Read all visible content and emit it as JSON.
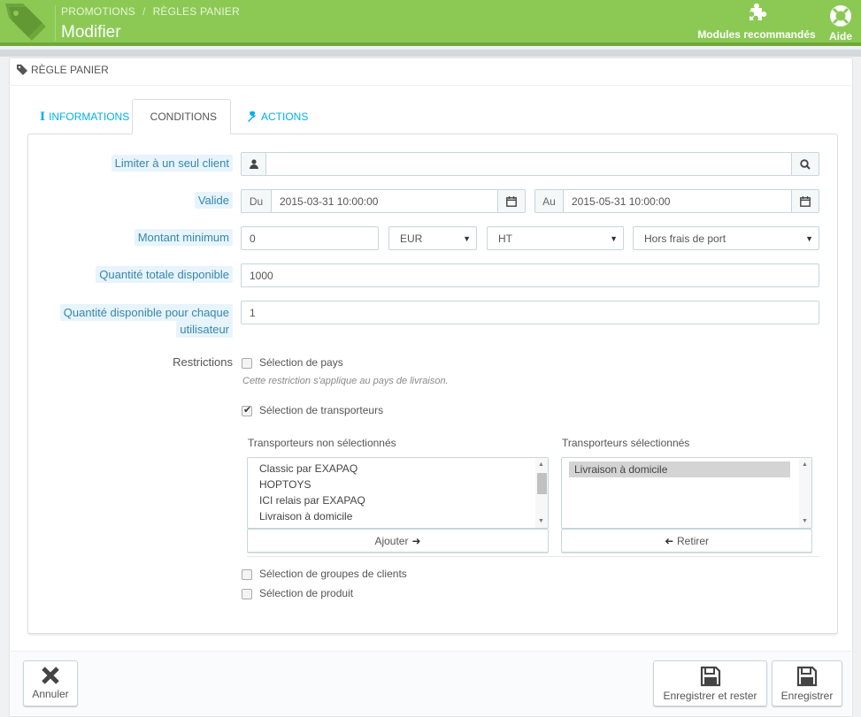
{
  "header": {
    "breadcrumb": [
      "PROMOTIONS",
      "RÈGLES PANIER"
    ],
    "breadcrumb_sep": "/",
    "title": "Modifier",
    "modules_label": "Modules recommandés",
    "help_label": "Aide"
  },
  "panel": {
    "title": "RÈGLE PANIER"
  },
  "tabs": [
    {
      "label": "INFORMATIONS",
      "icon": "info-icon"
    },
    {
      "label": "CONDITIONS",
      "icon": "shuffle-icon"
    },
    {
      "label": "ACTIONS",
      "icon": "wrench-icon"
    }
  ],
  "form": {
    "limit_client": {
      "label": "Limiter à un seul client",
      "value": ""
    },
    "valid": {
      "label": "Valide",
      "from_prefix": "Du",
      "from": "2015-03-31 10:00:00",
      "to_prefix": "Au",
      "to": "2015-05-31 10:00:00"
    },
    "min_amount": {
      "label": "Montant minimum",
      "value": "0",
      "currency": "EUR",
      "tax": "HT",
      "shipping": "Hors frais de port"
    },
    "total_qty": {
      "label": "Quantité totale disponible",
      "value": "1000"
    },
    "qty_per_user": {
      "label_line1": "Quantité disponible pour chaque",
      "label_line2": "utilisateur",
      "value": "1"
    },
    "restrictions": {
      "label": "Restrictions",
      "country": {
        "label": "Sélection de pays",
        "checked": false,
        "help": "Cette restriction s'applique au pays de livraison."
      },
      "carriers": {
        "label": "Sélection de transporteurs",
        "checked": true,
        "unselected_title": "Transporteurs non sélectionnés",
        "unselected": [
          "Classic par EXAPAQ",
          "HOPTOYS",
          "ICI relais par EXAPAQ",
          "Livraison à domicile"
        ],
        "selected_title": "Transporteurs sélectionnés",
        "selected": [
          "Livraison à domicile"
        ],
        "add_label": "Ajouter",
        "remove_label": "Retirer"
      },
      "groups": {
        "label": "Sélection de groupes de clients",
        "checked": false
      },
      "products": {
        "label": "Sélection de produit",
        "checked": false
      }
    }
  },
  "footer": {
    "cancel_label": "Annuler",
    "save_stay_label": "Enregistrer et rester",
    "save_label": "Enregistrer"
  },
  "colors": {
    "header_green": "#8bc954",
    "link_blue": "#00aff0",
    "label_highlight": "#e8f4fb"
  }
}
